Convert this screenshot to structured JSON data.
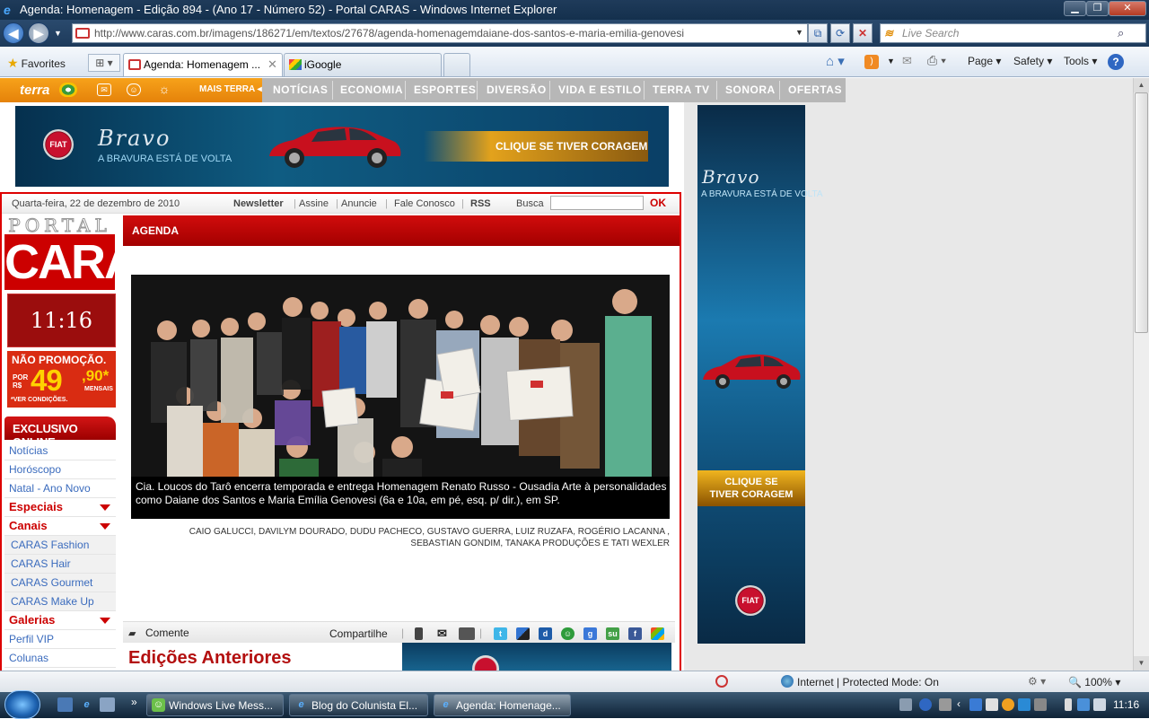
{
  "window": {
    "title": "Agenda: Homenagem - Edição 894 - (Ano 17 - Número 52) - Portal CARAS - Windows Internet Explorer"
  },
  "address_bar": {
    "url": "http://www.caras.com.br/imagens/186271/em/textos/27678/agenda-homenagemdaiane-dos-santos-e-maria-emilia-genovesi",
    "search_placeholder": "Live Search"
  },
  "command_bar": {
    "favorites_label": "Favorites",
    "tabs": [
      {
        "label": "Agenda: Homenagem ...",
        "active": true
      },
      {
        "label": "iGoogle",
        "active": false
      }
    ],
    "page_menu": "Page",
    "safety_menu": "Safety",
    "tools_menu": "Tools",
    "icons": [
      "home-icon",
      "feeds-icon",
      "mail-icon",
      "print-icon",
      "help-icon"
    ]
  },
  "terra_nav": {
    "logo": "terra",
    "mais_terra": "MAIS TERRA",
    "items": [
      "NOTÍCIAS",
      "ECONOMIA",
      "ESPORTES",
      "DIVERSÃO",
      "VIDA E ESTILO",
      "TERRA TV",
      "SONORA",
      "OFERTAS"
    ]
  },
  "banner_top": {
    "brand": "Bravo",
    "tagline": "A BRAVURA ESTÁ DE VOLTA",
    "cta": "CLIQUE SE TIVER CORAGEM",
    "fiat": "FIAT"
  },
  "date_bar": {
    "date": "Quarta-feira, 22 de dezembro de 2010",
    "links": [
      "Newsletter",
      "Assine",
      "Anuncie",
      "Fale Conosco",
      "RSS"
    ],
    "search_label": "Busca",
    "search_button": "OK"
  },
  "logo": {
    "top": "PORTAL",
    "main": "CARAS"
  },
  "clock": "11:16",
  "promo": {
    "headline": "NÃO PROMOÇÃO.",
    "por": "POR R$",
    "price": "49",
    "cents": ",90*",
    "mensais": "MENSAIS",
    "note": "*VER CONDIÇÕES."
  },
  "exclusive_menu": {
    "header": "EXCLUSIVO ONLINE",
    "items": [
      {
        "label": "Notícias",
        "type": "link"
      },
      {
        "label": "Horóscopo",
        "type": "link"
      },
      {
        "label": "Natal - Ano Novo",
        "type": "link"
      },
      {
        "label": "Especiais",
        "type": "header"
      },
      {
        "label": "Canais",
        "type": "header"
      },
      {
        "label": "CARAS Fashion",
        "type": "sub"
      },
      {
        "label": "CARAS Hair",
        "type": "sub"
      },
      {
        "label": "CARAS Gourmet",
        "type": "sub"
      },
      {
        "label": "CARAS Make Up",
        "type": "sub"
      },
      {
        "label": "Galerias",
        "type": "header"
      },
      {
        "label": "Perfil VIP",
        "type": "link"
      },
      {
        "label": "Colunas",
        "type": "link"
      }
    ]
  },
  "article": {
    "section": "AGENDA",
    "caption": "Cia. Loucos do Tarô encerra temporada e entrega Homenagem Renato Russo - Ousadia Arte à personalidades como Daiane dos Santos e Maria Emília Genovesi (6a e 10a, em pé, esq. p/ dir.), em SP.",
    "credits_line1": "CAIO GALUCCI, DAVILYM DOURADO, DUDU PACHECO, GUSTAVO GUERRA, LUIZ RUZAFA, ROGÉRIO LACANNA ,",
    "credits_line2": "SEBASTIAN GONDIM, TANAKA PRODUÇÕES E TATI WEXLER",
    "comment_label": "Comente",
    "share_label": "Compartilhe",
    "share_icons": [
      "mobile-icon",
      "email-icon",
      "print-icon",
      "twitter-icon",
      "delicious-icon",
      "digg-icon",
      "chat-icon",
      "google-icon",
      "stumbleupon-icon",
      "facebook-icon",
      "windows-icon"
    ],
    "previous_editions": "Edições Anteriores"
  },
  "sky_ad": {
    "brand": "Bravo",
    "tagline": "A BRAVURA ESTÁ DE VOLTA",
    "cta_line1": "CLIQUE SE",
    "cta_line2": "TIVER CORAGEM",
    "fiat": "FIAT"
  },
  "status_bar": {
    "zone": "Internet | Protected Mode: On",
    "zoom": "100%"
  },
  "taskbar": {
    "tasks": [
      {
        "label": "Windows Live Mess...",
        "active": false
      },
      {
        "label": "Blog do Colunista El...",
        "active": false
      },
      {
        "label": "Agenda: Homenage...",
        "active": true
      }
    ],
    "clock": "11:16"
  },
  "colors": {
    "caras_red": "#cc0000",
    "terra_orange": "#f39200",
    "ie_titlebar": "#1f3b5a"
  }
}
